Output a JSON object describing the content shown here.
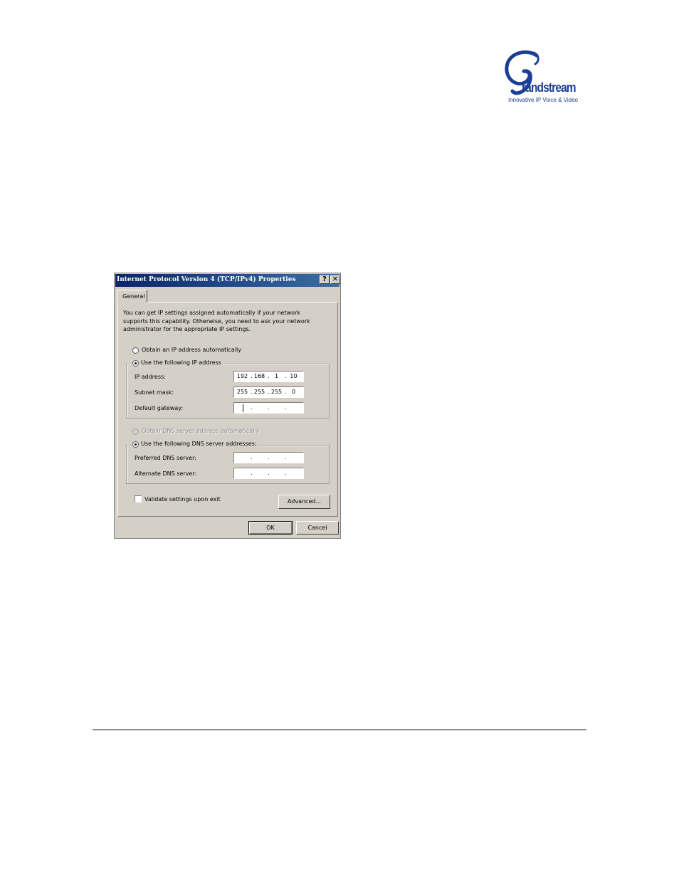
{
  "logo": {
    "brand": "randstream",
    "tagline": "Innovative IP Voice & Video",
    "color": "#1c3f95"
  },
  "dialog": {
    "title": "Internet Protocol Version 4 (TCP/IPv4) Properties",
    "help_label": "?",
    "close_label": "✕",
    "tab_label": "General",
    "description": "You can get IP settings assigned automatically if your network supports this capability. Otherwise, you need to ask your network administrator for the appropriate IP settings.",
    "ip_mode": {
      "auto_label": "Obtain an IP address automatically",
      "manual_label": "Use the following IP address",
      "selected": "manual"
    },
    "ip_fields": {
      "ip_address_label": "IP address:",
      "ip_address": [
        "192",
        "168",
        "1",
        "10"
      ],
      "subnet_label": "Subnet mask:",
      "subnet": [
        "255",
        "255",
        "255",
        "0"
      ],
      "gateway_label": "Default gateway:",
      "gateway": [
        "",
        "",
        "",
        ""
      ]
    },
    "dns_mode": {
      "auto_label": "Obtain DNS server address automatically",
      "manual_label": "Use the following DNS server addresses:",
      "selected": "manual"
    },
    "dns_fields": {
      "preferred_label": "Preferred DNS server:",
      "preferred": [
        "",
        "",
        "",
        ""
      ],
      "alternate_label": "Alternate DNS server:",
      "alternate": [
        "",
        "",
        "",
        ""
      ]
    },
    "validate_label": "Validate settings upon exit",
    "validate_checked": false,
    "advanced_label": "Advanced...",
    "ok_label": "OK",
    "cancel_label": "Cancel"
  }
}
